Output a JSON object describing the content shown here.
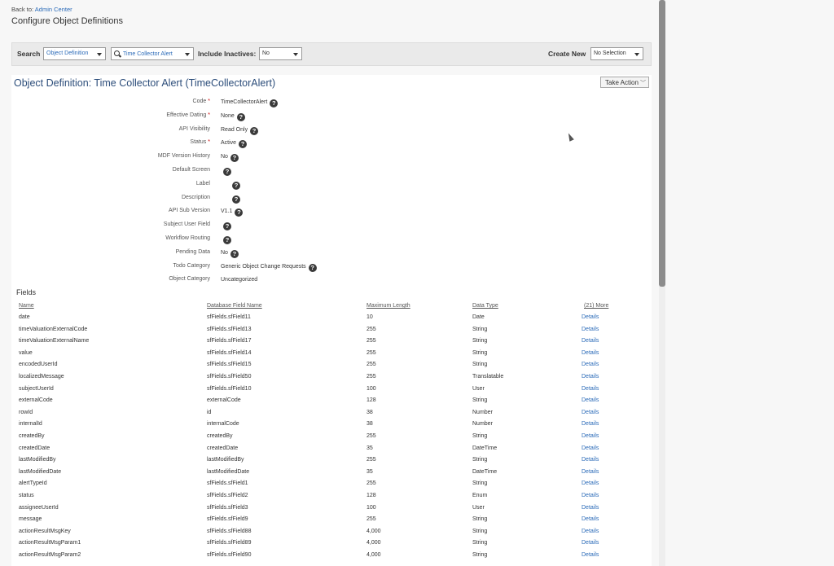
{
  "header": {
    "back_prefix": "Back to:",
    "back_link": "Admin Center",
    "title": "Configure Object Definitions"
  },
  "search": {
    "search_label": "Search",
    "type_value": "Object Definition",
    "object_value": "Time Collector Alert",
    "include_inactives_label": "Include Inactives:",
    "include_inactives_value": "No",
    "create_new_label": "Create New",
    "create_new_value": "No Selection"
  },
  "object": {
    "title": "Object Definition: Time Collector Alert (TimeCollectorAlert)",
    "take_action": "Take Action"
  },
  "properties": [
    {
      "label": "Code",
      "required": true,
      "value": "TimeCollectorAlert",
      "help": true
    },
    {
      "label": "Effective Dating",
      "required": true,
      "value": "None",
      "help": true
    },
    {
      "label": "API Visibility",
      "required": false,
      "value": "Read Only",
      "help": true
    },
    {
      "label": "Status",
      "required": true,
      "value": "Active",
      "help": true
    },
    {
      "label": "MDF Version History",
      "required": false,
      "value": "No",
      "help": true
    },
    {
      "label": "Default Screen",
      "required": false,
      "value": "",
      "help": true
    },
    {
      "label": "Label",
      "required": false,
      "value": "",
      "help": true
    },
    {
      "label": "Description",
      "required": false,
      "value": "",
      "help": true
    },
    {
      "label": "API Sub Version",
      "required": false,
      "value": "V1.1",
      "help": true
    },
    {
      "label": "Subject User Field",
      "required": false,
      "value": "",
      "help": true
    },
    {
      "label": "Workflow Routing",
      "required": false,
      "value": "",
      "help": true
    },
    {
      "label": "Pending Data",
      "required": false,
      "value": "No",
      "help": true
    },
    {
      "label": "Todo Category",
      "required": false,
      "value": "Generic Object Change Requests",
      "help": true
    },
    {
      "label": "Object Category",
      "required": false,
      "value": "Uncategorized",
      "help": false
    }
  ],
  "fields": {
    "title": "Fields",
    "columns": [
      "Name",
      "Database Field Name",
      "Maximum Length",
      "Data Type",
      "(21) More"
    ],
    "details_label": "Details",
    "rows": [
      [
        "date",
        "sfFields.sfField11",
        "10",
        "Date"
      ],
      [
        "timeValuationExternalCode",
        "sfFields.sfField13",
        "255",
        "String"
      ],
      [
        "timeValuationExternalName",
        "sfFields.sfField17",
        "255",
        "String"
      ],
      [
        "value",
        "sfFields.sfField14",
        "255",
        "String"
      ],
      [
        "encodedUserId",
        "sfFields.sfField15",
        "255",
        "String"
      ],
      [
        "localizedMessage",
        "sfFields.sfField50",
        "255",
        "Translatable"
      ],
      [
        "subjectUserId",
        "sfFields.sfField10",
        "100",
        "User"
      ],
      [
        "externalCode",
        "externalCode",
        "128",
        "String"
      ],
      [
        "rowId",
        "id",
        "38",
        "Number"
      ],
      [
        "internalId",
        "internalCode",
        "38",
        "Number"
      ],
      [
        "createdBy",
        "createdBy",
        "255",
        "String"
      ],
      [
        "createdDate",
        "createdDate",
        "35",
        "DateTime"
      ],
      [
        "lastModifiedBy",
        "lastModifiedBy",
        "255",
        "String"
      ],
      [
        "lastModifiedDate",
        "lastModifiedDate",
        "35",
        "DateTime"
      ],
      [
        "alertTypeId",
        "sfFields.sfField1",
        "255",
        "String"
      ],
      [
        "status",
        "sfFields.sfField2",
        "128",
        "Enum"
      ],
      [
        "assigneeUserId",
        "sfFields.sfField3",
        "100",
        "User"
      ],
      [
        "message",
        "sfFields.sfField9",
        "255",
        "String"
      ],
      [
        "actionResultMsgKey",
        "sfFields.sfField88",
        "4,000",
        "String"
      ],
      [
        "actionResultMsgParam1",
        "sfFields.sfField89",
        "4,000",
        "String"
      ],
      [
        "actionResultMsgParam2",
        "sfFields.sfField90",
        "4,000",
        "String"
      ]
    ]
  }
}
